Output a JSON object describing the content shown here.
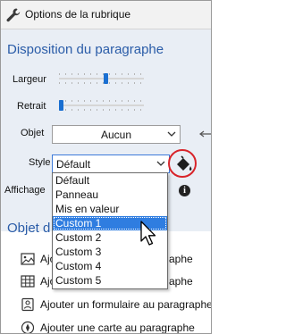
{
  "title": "Options de la rubrique",
  "section_disposition": {
    "title": "Disposition du paragraphe",
    "largeur_label": "Largeur",
    "largeur_value": 0.55,
    "retrait_label": "Retrait",
    "retrait_value": 0.0,
    "objet_label": "Objet",
    "objet_value": "Aucun",
    "style_label": "Style",
    "style_value": "Défault",
    "affichage_label": "Affichage"
  },
  "style_dropdown": {
    "options": [
      "Défault",
      "Panneau",
      "Mis en valeur",
      "Custom 1",
      "Custom 2",
      "Custom 3",
      "Custom 4",
      "Custom 5"
    ],
    "highlighted": "Custom 1"
  },
  "section_objet": {
    "title_partial": "Objet d",
    "rows": [
      {
        "text": "Ajo",
        "tail": "aphe",
        "icon": "image-icon"
      },
      {
        "text": "Ajo",
        "tail": "aphe",
        "icon": "table-icon"
      },
      {
        "text": "Ajouter un formulaire au paragraphe",
        "icon": "form-icon"
      },
      {
        "text": "Ajouter une carte au paragraphe",
        "icon": "map-pin-icon"
      }
    ]
  },
  "colors": {
    "accent": "#2a5ca8",
    "selection": "#2f7de0",
    "highlight_circle": "#d8242a"
  }
}
